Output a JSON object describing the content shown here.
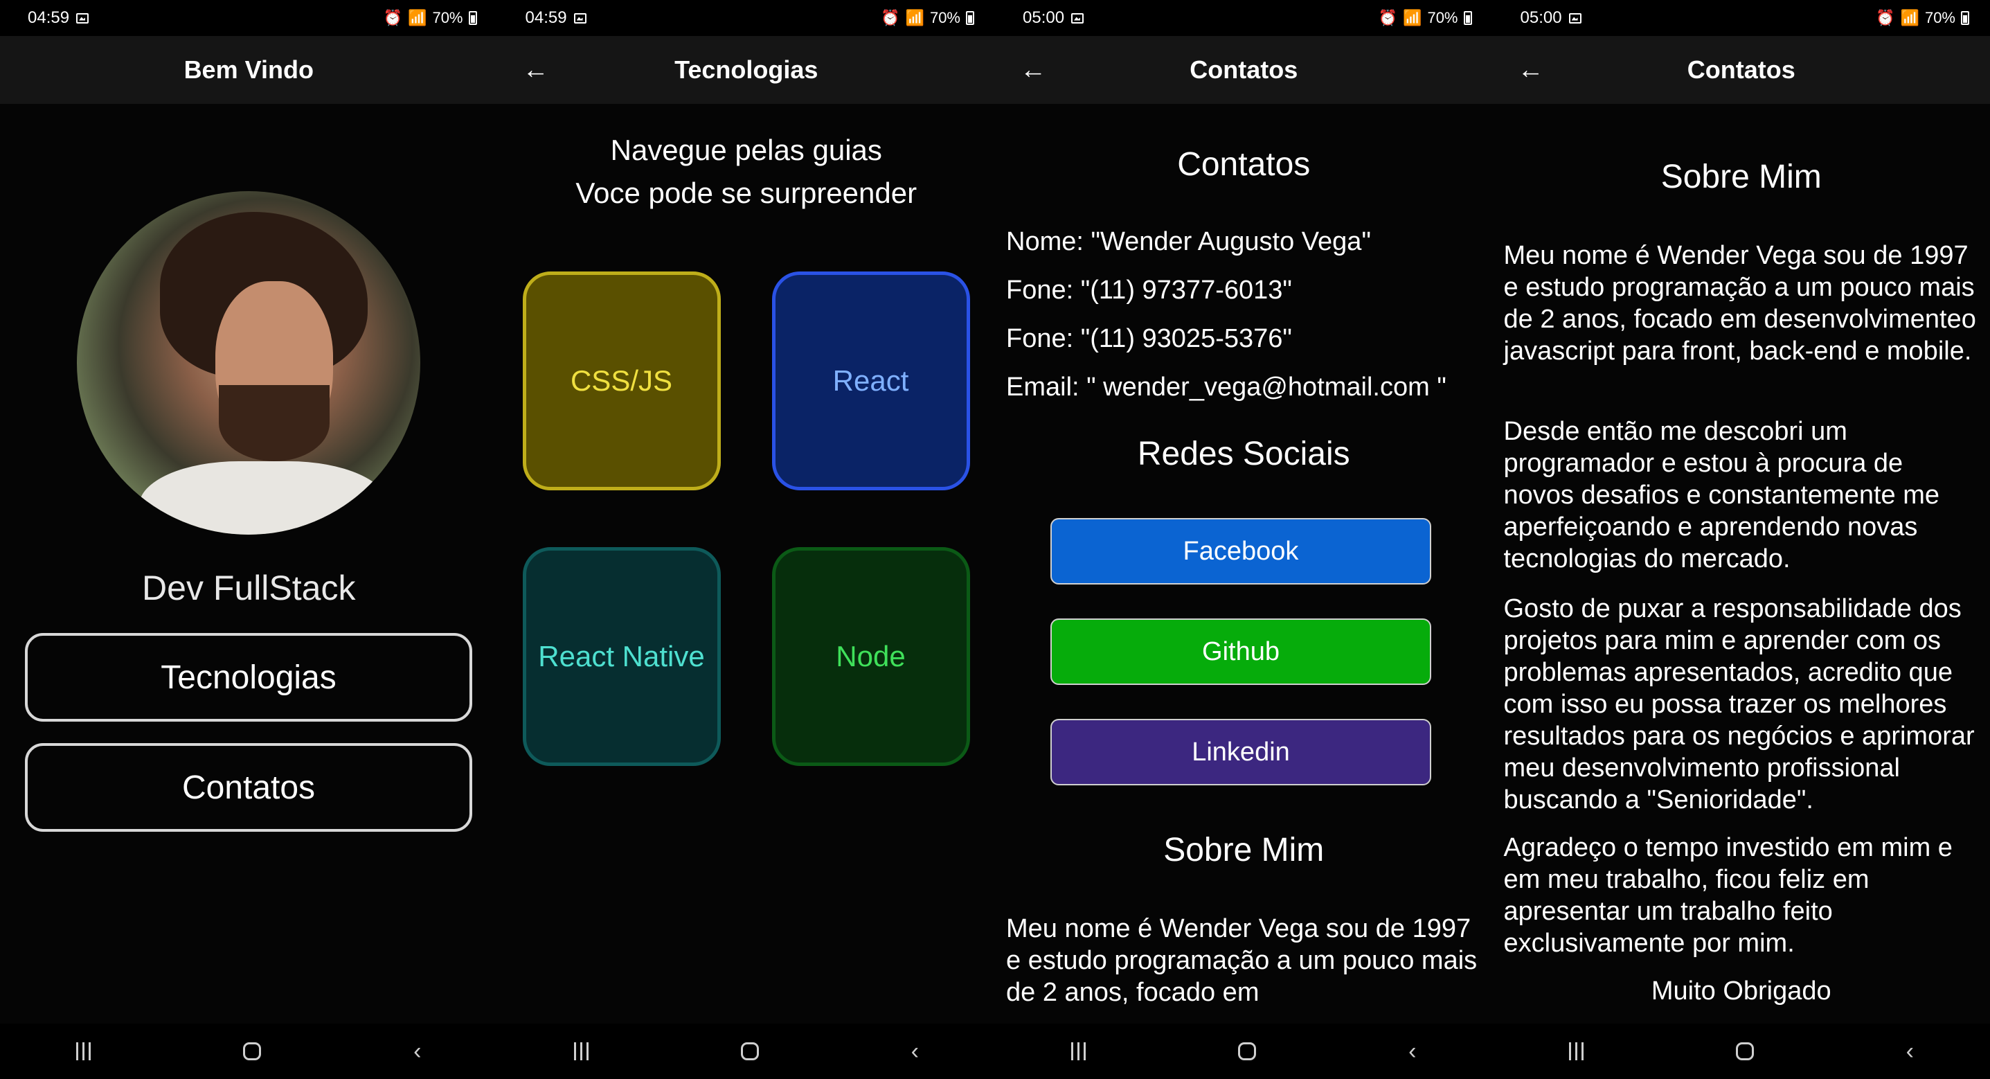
{
  "screens": [
    {
      "status": {
        "time": "04:59",
        "battery": "70%"
      },
      "title": "Bem Vindo",
      "role": "Dev FullStack",
      "buttons": [
        "Tecnologias",
        "Contatos"
      ]
    },
    {
      "status": {
        "time": "04:59",
        "battery": "70%"
      },
      "title": "Tecnologias",
      "intro": [
        "Navegue pelas guias",
        "Voce pode se surpreender"
      ],
      "tiles": [
        {
          "label": "CSS/JS",
          "bg": "#5a5000",
          "border": "#bfae1a",
          "text": "#f0e040"
        },
        {
          "label": "React",
          "bg": "#0a2366",
          "border": "#2a52e6",
          "text": "#7fb0ff"
        },
        {
          "label": "React Native",
          "bg": "#062e30",
          "border": "#0e5a5a",
          "text": "#4ee0d0"
        },
        {
          "label": "Node",
          "bg": "#062e0c",
          "border": "#0b5a16",
          "text": "#3fe05a"
        }
      ]
    },
    {
      "status": {
        "time": "05:00",
        "battery": "70%"
      },
      "title": "Contatos",
      "heading": "Contatos",
      "info": [
        "Nome: \"Wender Augusto Vega\"",
        "Fone: \"(11) 97377-6013\"",
        "Fone: \"(11) 93025-5376\"",
        "Email: \" wender_vega@hotmail.com \""
      ],
      "social_heading": "Redes Sociais",
      "social": [
        {
          "label": "Facebook",
          "color": "#0b64d2"
        },
        {
          "label": "Github",
          "color": "#06ac0b"
        },
        {
          "label": "Linkedin",
          "color": "#3c2780"
        }
      ],
      "about_heading": "Sobre Mim",
      "about_text": "Meu nome é Wender Vega sou de 1997 e estudo programação a um pouco mais de 2 anos, focado em"
    },
    {
      "status": {
        "time": "05:00",
        "battery": "70%"
      },
      "title": "Contatos",
      "about_heading": "Sobre Mim",
      "paragraphs": [
        "Meu nome é Wender Vega sou de 1997 e estudo programação a um pouco mais de 2 anos, focado em desenvolvimenteo javascript para front, back-end e mobile.",
        "Desde então me descobri um programador e estou à procura de novos desafios e constantemente me aperfeiçoando e aprendendo novas tecnologias do mercado.",
        "Gosto de puxar a responsabilidade dos projetos para mim e aprender com os problemas apresentados, acredito que com isso eu possa trazer os melhores resultados para os negócios e aprimorar meu desenvolvimento profissional buscando a \"Senioridade\".",
        "Agradeço o tempo investido em mim e em meu trabalho, ficou feliz em apresentar um trabalho feito exclusivamente por mim."
      ],
      "closing": "Muito Obrigado"
    }
  ]
}
